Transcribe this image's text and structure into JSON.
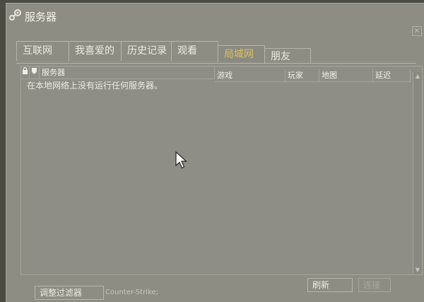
{
  "window": {
    "title": "服务器",
    "close_glyph": "×"
  },
  "tabs": [
    {
      "label": "互联网",
      "active": false
    },
    {
      "label": "我喜爱的",
      "active": false
    },
    {
      "label": "历史记录",
      "active": false
    },
    {
      "label": "观看",
      "active": false
    },
    {
      "label": "局域网",
      "active": true
    },
    {
      "label": "朋友",
      "active": false
    }
  ],
  "table": {
    "columns": {
      "lock_icon": "lock-icon",
      "shield_icon": "shield-icon",
      "servers": "服务器",
      "game": "游戏",
      "players": "玩家",
      "map": "地图",
      "latency": "延迟"
    },
    "empty_message": "在本地网络上没有运行任何服务器。",
    "scroll_up_glyph": "▲",
    "scroll_down_glyph": "▼"
  },
  "footer": {
    "filter_button": "调整过滤器",
    "game_filter": "Counter-Strike;",
    "refresh_button": "刷新",
    "connect_button": "连接"
  },
  "colors": {
    "active_tab_text": "#d9c060",
    "panel": "#8e8d84"
  }
}
